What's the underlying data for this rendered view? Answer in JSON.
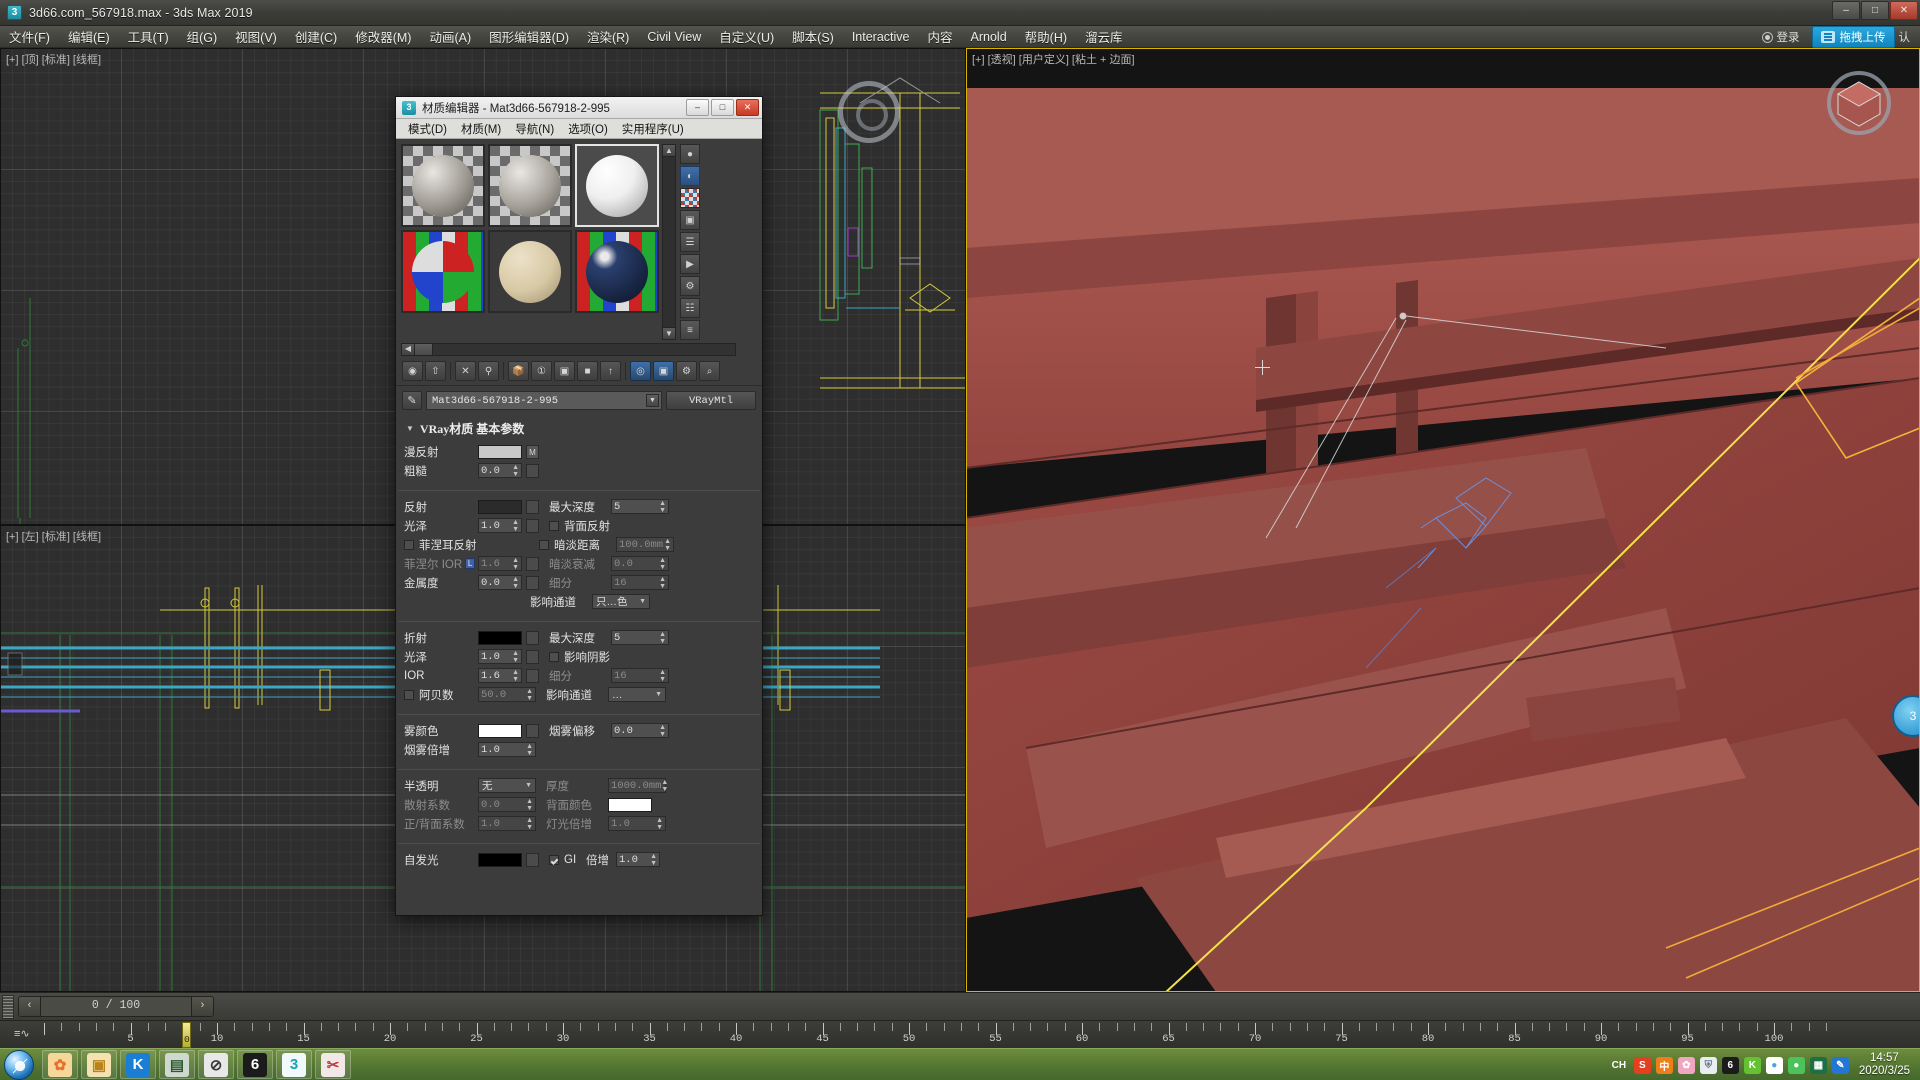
{
  "window": {
    "title": "3d66.com_567918.max - 3ds Max 2019",
    "icon": "max-logo-icon",
    "buttons": {
      "minimize": "–",
      "maximize": "□",
      "close": "✕"
    }
  },
  "menubar": {
    "items": [
      "文件(F)",
      "编辑(E)",
      "工具(T)",
      "组(G)",
      "视图(V)",
      "创建(C)",
      "修改器(M)",
      "动画(A)",
      "图形编辑器(D)",
      "渲染(R)",
      "Civil View",
      "自定义(U)",
      "脚本(S)",
      "Interactive",
      "内容",
      "Arnold",
      "帮助(H)",
      "溜云库"
    ],
    "login_label": "登录",
    "upload_label": "拖拽上传",
    "ren_label": "认"
  },
  "viewports": [
    {
      "id": "vp-top",
      "label": "[+] [顶] [标准] [线框]"
    },
    {
      "id": "vp-left",
      "label": "[+] [左] [标准] [线框]"
    },
    {
      "id": "vp-persp",
      "label": "[+] [透视] [用户定义] [粘土 + 边面]"
    }
  ],
  "material_editor": {
    "icon": "max-logo-icon",
    "title": "材质编辑器 - Mat3d66-567918-2-995",
    "window_buttons": {
      "minimize": "–",
      "maximize": "□",
      "close": "✕"
    },
    "menu": [
      "模式(D)",
      "材质(M)",
      "导航(N)",
      "选项(O)",
      "实用程序(U)"
    ],
    "slots": [
      {
        "name": "slot-1",
        "style": "stone-checker",
        "selected": false
      },
      {
        "name": "slot-2",
        "style": "stone-checker",
        "selected": false
      },
      {
        "name": "slot-3",
        "style": "plain-white",
        "selected": true
      },
      {
        "name": "slot-4",
        "style": "rgb-checker",
        "selected": false
      },
      {
        "name": "slot-5",
        "style": "sand",
        "selected": false
      },
      {
        "name": "slot-6",
        "style": "rgb-dark",
        "selected": false
      }
    ],
    "material_name": "Mat3d66-567918-2-995",
    "material_type": "VRayMtl",
    "rollout_title": "VRay材质  基本参数",
    "params": {
      "diffuse": {
        "label": "漫反射",
        "color": "#c8c8c8",
        "map": "M"
      },
      "roughness": {
        "label": "粗糙",
        "value": "0.0"
      },
      "reflect": {
        "label": "反射",
        "color": "#2b2b2b"
      },
      "max_depth_refl": {
        "label": "最大深度",
        "value": "5"
      },
      "gloss_refl": {
        "label": "光泽",
        "value": "1.0"
      },
      "back_refl": {
        "label": "背面反射",
        "checked": false
      },
      "fresnel": {
        "label": "菲涅耳反射",
        "checked": false
      },
      "dim_distance": {
        "label": "暗淡距离",
        "checked": false,
        "value": "100.0mm"
      },
      "fresnel_ior": {
        "label": "菲涅尔 IOR",
        "value": "1.6",
        "badge": "L",
        "dim": true
      },
      "dim_falloff": {
        "label": "暗淡衰减",
        "value": "0.0",
        "dim": true
      },
      "metalness": {
        "label": "金属度",
        "value": "0.0"
      },
      "subdivs_refl": {
        "label": "细分",
        "value": "16",
        "dim": true
      },
      "affect_ch_refl": {
        "label": "影响通道",
        "value": "只…色"
      },
      "refract": {
        "label": "折射",
        "color": "#000000"
      },
      "max_depth_refr": {
        "label": "最大深度",
        "value": "5"
      },
      "gloss_refr": {
        "label": "光泽",
        "value": "1.0"
      },
      "affect_shadow": {
        "label": "影响阴影",
        "checked": false
      },
      "ior": {
        "label": "IOR",
        "value": "1.6"
      },
      "subdivs_refr": {
        "label": "细分",
        "value": "16",
        "dim": true
      },
      "abbe": {
        "label": "阿贝数",
        "checked": false,
        "value": "50.0",
        "dim": true
      },
      "affect_ch_refr": {
        "label": "影响通道",
        "value": "…"
      },
      "fog_color": {
        "label": "雾颜色",
        "color": "#ffffff"
      },
      "fog_bias": {
        "label": "烟雾偏移",
        "value": "0.0"
      },
      "fog_multiplier": {
        "label": "烟雾倍增",
        "value": "1.0"
      },
      "translucency": {
        "label": "半透明",
        "value": "无"
      },
      "thickness": {
        "label": "厚度",
        "value": "1000.0mm",
        "dim": true
      },
      "scatter_coeff": {
        "label": "散射系数",
        "value": "0.0",
        "dim": true
      },
      "back_color": {
        "label": "背面颜色",
        "color": "#ffffff",
        "dim": true
      },
      "fwd_back_coeff": {
        "label": "正/背面系数",
        "value": "1.0",
        "dim": true
      },
      "light_multiplier": {
        "label": "灯光倍增",
        "value": "1.0",
        "dim": true
      },
      "self_illum": {
        "label": "自发光",
        "color": "#000000"
      },
      "gi_label": {
        "label": "GI",
        "checked": true
      },
      "illum_mult": {
        "label": "倍增",
        "value": "1.0"
      }
    }
  },
  "timeline": {
    "frame_display": "0 / 100",
    "prev_icon": "‹",
    "next_icon": "›",
    "current_frame": "0",
    "tick_labels": [
      "5",
      "10",
      "15",
      "20",
      "25",
      "30",
      "35",
      "40",
      "45",
      "50",
      "55",
      "60",
      "65",
      "70",
      "75",
      "80",
      "85",
      "90",
      "95",
      "100"
    ],
    "sound_icon": "audio-waveform-icon"
  },
  "taskbar": {
    "start_label": "start-orb-icon",
    "apps": [
      {
        "name": "firefox-icon",
        "glyph": "✿",
        "color": "#e8702a",
        "bg": "#f6d79a"
      },
      {
        "name": "folder-icon",
        "glyph": "▣",
        "color": "#b98318",
        "bg": "#f4e2b0"
      },
      {
        "name": "kingsoft-icon",
        "glyph": "K",
        "color": "#ffffff",
        "bg": "#1a7fd4"
      },
      {
        "name": "computer-icon",
        "glyph": "▤",
        "color": "#2c5a2c",
        "bg": "#cfd8cf"
      },
      {
        "name": "compass-icon",
        "glyph": "⊘",
        "color": "#3a3a3a",
        "bg": "#e8e8e8"
      },
      {
        "name": "cad-2019-icon",
        "glyph": "6",
        "color": "#ffffff",
        "bg": "#1b1b1b"
      },
      {
        "name": "3dsmax-icon",
        "glyph": "3",
        "color": "#18a3b5",
        "bg": "#f2f9fb"
      },
      {
        "name": "sketch-tool-icon",
        "glyph": "✂",
        "color": "#c23a3a",
        "bg": "#f3e8e8"
      }
    ],
    "tray": [
      {
        "name": "input-method-icon",
        "glyph": "CH",
        "bg": "transparent",
        "color": "#ffffff"
      },
      {
        "name": "sogou-icon",
        "glyph": "S",
        "bg": "#e2401f",
        "color": "#ffffff"
      },
      {
        "name": "ime-chinese-icon",
        "glyph": "中",
        "bg": "#ef7d1a",
        "color": "#ffffff"
      },
      {
        "name": "flower-icon",
        "glyph": "✿",
        "bg": "#f0a6c0",
        "color": "#ffffff"
      },
      {
        "name": "shield-icon",
        "glyph": "⛨",
        "bg": "#e9edf2",
        "color": "#6a7a8a"
      },
      {
        "name": "cad-tray-icon",
        "glyph": "6",
        "bg": "#1b1b1b",
        "color": "#ffffff"
      },
      {
        "name": "kingsoft-tray-icon",
        "glyph": "K",
        "bg": "#63c132",
        "color": "#ffffff"
      },
      {
        "name": "360-icon",
        "glyph": "●",
        "bg": "#ffffff",
        "color": "#3fa9dd"
      },
      {
        "name": "wechat-icon",
        "glyph": "●",
        "bg": "#4cc35a",
        "color": "#ffffff"
      },
      {
        "name": "excel-icon",
        "glyph": "▦",
        "bg": "#1d7044",
        "color": "#ffffff"
      },
      {
        "name": "editor-icon",
        "glyph": "✎",
        "bg": "#2277d6",
        "color": "#ffffff"
      }
    ],
    "clock_time": "14:57",
    "clock_date": "2020/3/25"
  }
}
